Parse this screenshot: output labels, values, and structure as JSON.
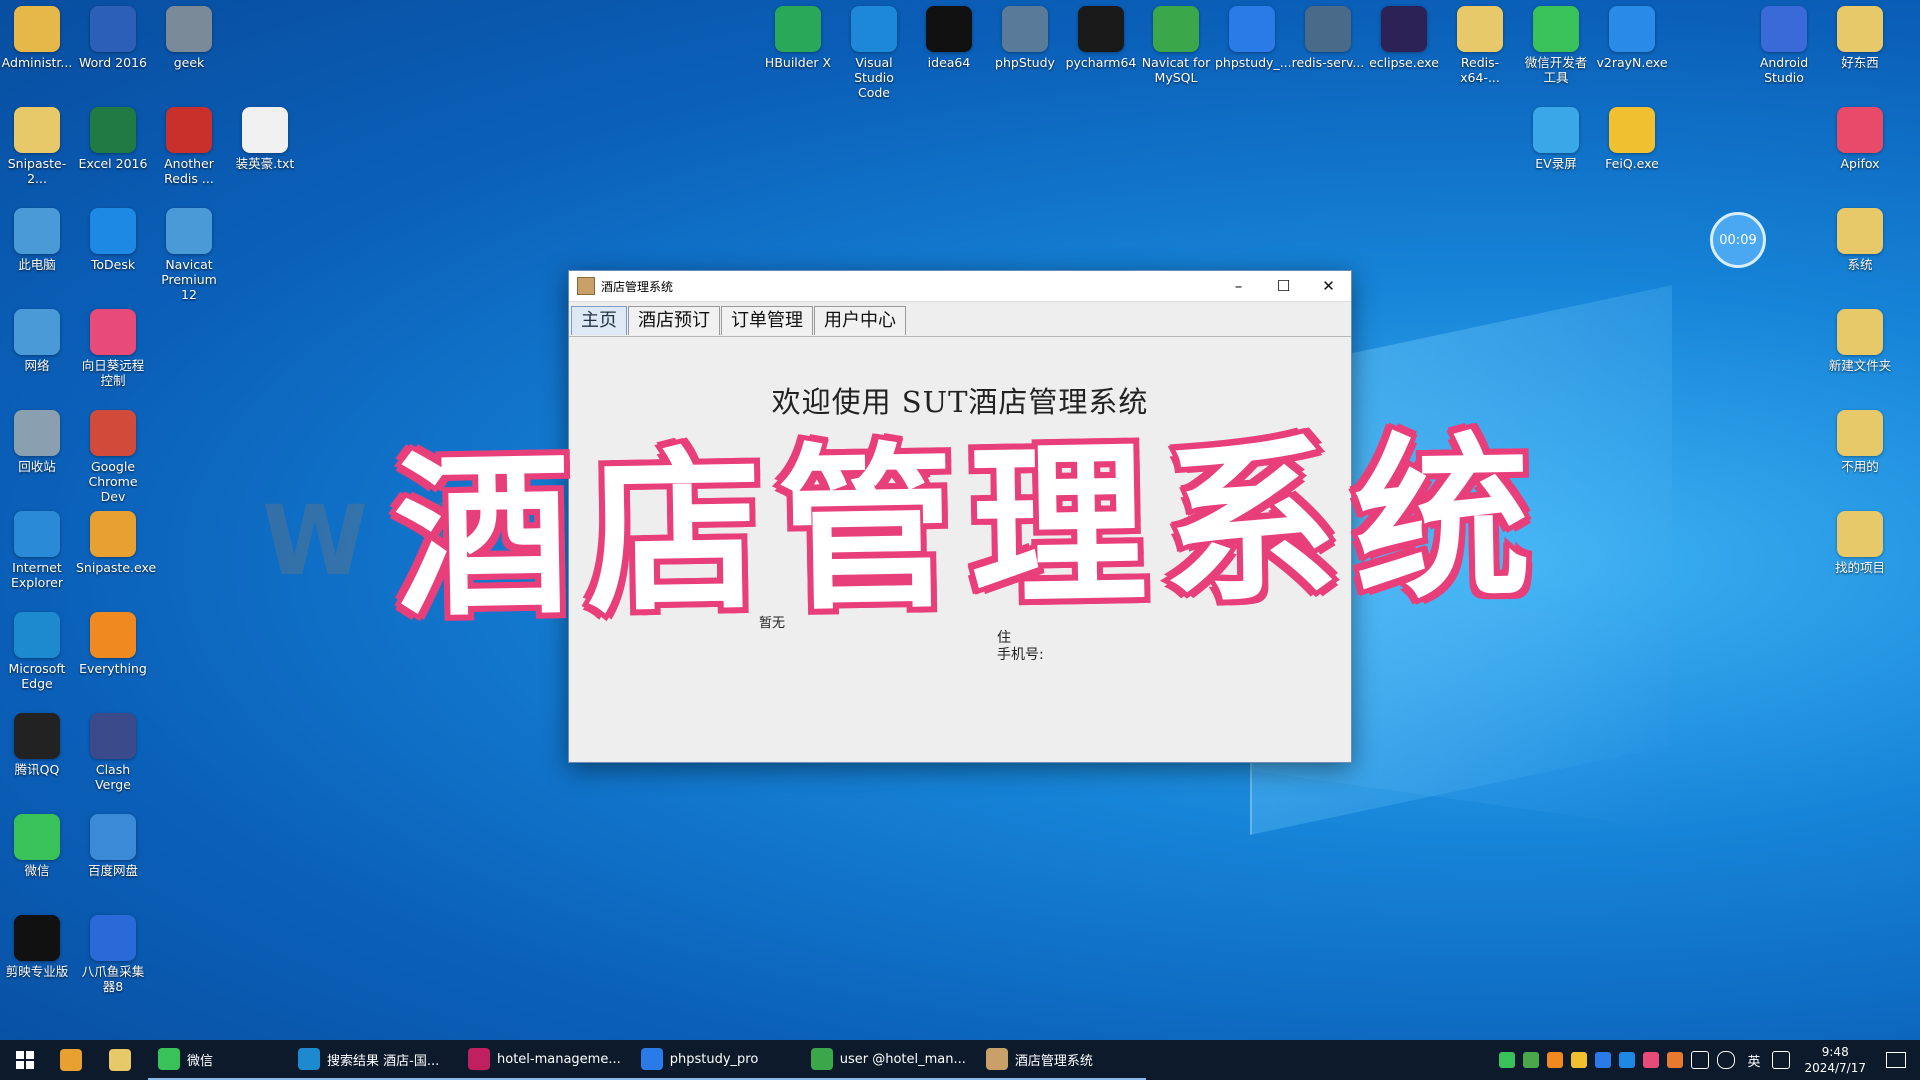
{
  "desktop_left": [
    {
      "label": "Administr...",
      "icon": "user-folder-icon",
      "color": "#e6b84a"
    },
    {
      "label": "Word 2016",
      "icon": "word-icon",
      "color": "#2b5fb8"
    },
    {
      "label": "geek",
      "icon": "trash-bin-icon",
      "color": "#7a8a99"
    },
    {
      "label": "Snipaste-2...",
      "icon": "folder-icon",
      "color": "#e8c96a"
    },
    {
      "label": "Excel 2016",
      "icon": "excel-icon",
      "color": "#1f7a44"
    },
    {
      "label": "Another Redis ...",
      "icon": "redis-icon",
      "color": "#c9302c"
    },
    {
      "label": "装英豪.txt",
      "icon": "text-file-icon",
      "color": "#f0f0f0"
    },
    {
      "label": "此电脑",
      "icon": "computer-icon",
      "color": "#4a9ad8"
    },
    {
      "label": "ToDesk",
      "icon": "todesk-icon",
      "color": "#1e88e5"
    },
    {
      "label": "Navicat Premium 12",
      "icon": "navicat-icon",
      "color": "#4a9ad8"
    },
    {
      "label": "网络",
      "icon": "network-icon",
      "color": "#4a9ad8"
    },
    {
      "label": "向日葵远程控制",
      "icon": "sunflower-icon",
      "color": "#e84a7a"
    },
    {
      "label": "回收站",
      "icon": "recycle-bin-icon",
      "color": "#8aa0b0"
    },
    {
      "label": "Google Chrome Dev",
      "icon": "chrome-dev-icon",
      "color": "#d24a3a"
    },
    {
      "label": "Internet Explorer",
      "icon": "ie-icon",
      "color": "#2a8ad8"
    },
    {
      "label": "Snipaste.exe",
      "icon": "snipaste-icon",
      "color": "#e8a030"
    },
    {
      "label": "Microsoft Edge",
      "icon": "edge-icon",
      "color": "#1d8ad0"
    },
    {
      "label": "Everything",
      "icon": "search-icon",
      "color": "#f08a20"
    },
    {
      "label": "腾讯QQ",
      "icon": "qq-icon",
      "color": "#222222"
    },
    {
      "label": "Clash Verge",
      "icon": "clash-icon",
      "color": "#3a4a8a"
    },
    {
      "label": "微信",
      "icon": "wechat-icon",
      "color": "#3ac25a"
    },
    {
      "label": "百度网盘",
      "icon": "baidu-pan-icon",
      "color": "#3a8ad8"
    },
    {
      "label": "剪映专业版",
      "icon": "jianying-icon",
      "color": "#111111"
    },
    {
      "label": "八爪鱼采集器8",
      "icon": "octopus-icon",
      "color": "#2a6ad8"
    }
  ],
  "desktop_top": [
    {
      "label": "HBuilder X",
      "icon": "hbuilder-icon",
      "color": "#2aa85a"
    },
    {
      "label": "Visual Studio Code",
      "icon": "vscode-icon",
      "color": "#1e88d8"
    },
    {
      "label": "idea64",
      "icon": "idea-icon",
      "color": "#111111"
    },
    {
      "label": "phpStudy",
      "icon": "phpstudy-icon",
      "color": "#5a7a9a"
    },
    {
      "label": "pycharm64",
      "icon": "pycharm-icon",
      "color": "#1a1a1a"
    },
    {
      "label": "Navicat for MySQL",
      "icon": "navicat-mysql-icon",
      "color": "#3aa84a"
    },
    {
      "label": "phpstudy_...",
      "icon": "phpstudy-pro-icon",
      "color": "#2a7ae8"
    },
    {
      "label": "redis-serv...",
      "icon": "redis-server-icon",
      "color": "#4a6a8a"
    },
    {
      "label": "eclipse.exe",
      "icon": "eclipse-icon",
      "color": "#2c2255"
    },
    {
      "label": "Redis-x64-...",
      "icon": "folder-icon",
      "color": "#e8c96a"
    },
    {
      "label": "微信开发者工具",
      "icon": "wechat-devtools-icon",
      "color": "#3ac25a"
    },
    {
      "label": "v2rayN.exe",
      "icon": "v2ray-icon",
      "color": "#2a8ae8"
    },
    {
      "label": "Android Studio",
      "icon": "android-studio-icon",
      "color": "#3a6ad8"
    },
    {
      "label": "好东西",
      "icon": "folder-icon",
      "color": "#e8c96a"
    }
  ],
  "desktop_right": [
    {
      "label": "EV录屏",
      "icon": "ev-recorder-icon",
      "color": "#3aa8e8"
    },
    {
      "label": "FeiQ.exe",
      "icon": "feiq-icon",
      "color": "#f0c030"
    },
    {
      "label": "Apifox",
      "icon": "apifox-icon",
      "color": "#e84a6a"
    },
    {
      "label": "系统",
      "icon": "folder-icon",
      "color": "#e8c96a"
    },
    {
      "label": "新建文件夹",
      "icon": "folder-icon",
      "color": "#e8c96a"
    },
    {
      "label": "不用的",
      "icon": "folder-icon",
      "color": "#e8c96a"
    },
    {
      "label": "找的项目",
      "icon": "folder-icon",
      "color": "#e8c96a"
    }
  ],
  "timer": "00:09",
  "window": {
    "title": "酒店管理系统",
    "minimize": "–",
    "maximize": "☐",
    "close": "✕",
    "tabs": [
      "主页",
      "酒店预订",
      "订单管理",
      "用户中心"
    ],
    "active_tab": 0,
    "welcome": "欢迎使用   SUT酒店管理系统",
    "note_left": "暂无",
    "note_name": "住",
    "note_phone": "手机号:"
  },
  "overlay_title": "酒店管理系统",
  "watermark": "W       8",
  "taskbar": {
    "items": [
      {
        "label": "微信",
        "icon": "wechat-icon",
        "color": "#3ac25a"
      },
      {
        "label": "搜索结果 酒店-国...",
        "icon": "edge-icon",
        "color": "#1d8ad0"
      },
      {
        "label": "hotel-manageme...",
        "icon": "idea-icon",
        "color": "#c02060"
      },
      {
        "label": "phpstudy_pro",
        "icon": "phpstudy-pro-icon",
        "color": "#2a7ae8"
      },
      {
        "label": "user @hotel_man...",
        "icon": "navicat-mysql-icon",
        "color": "#3aa84a"
      },
      {
        "label": "酒店管理系统",
        "icon": "java-app-icon",
        "color": "#c9a06a"
      }
    ],
    "ime": "英",
    "time": "9:48",
    "date": "2024/7/17"
  }
}
